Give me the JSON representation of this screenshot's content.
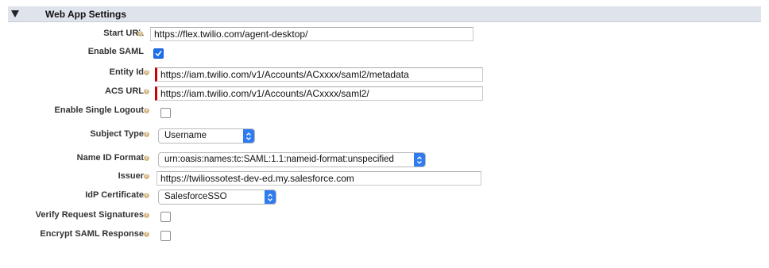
{
  "section": {
    "title": "Web App Settings"
  },
  "fields": {
    "start_url": {
      "label": "Start URL",
      "value": "https://flex.twilio.com/agent-desktop/"
    },
    "enable_saml": {
      "label": "Enable SAML",
      "checked": true
    },
    "entity_id": {
      "label": "Entity Id",
      "value": "https://iam.twilio.com/v1/Accounts/ACxxxx/saml2/metadata"
    },
    "acs_url": {
      "label": "ACS URL",
      "value": "https://iam.twilio.com/v1/Accounts/ACxxxx/saml2/"
    },
    "enable_single_logout": {
      "label": "Enable Single Logout",
      "checked": false
    },
    "subject_type": {
      "label": "Subject Type",
      "value": "Username"
    },
    "name_id_format": {
      "label": "Name ID Format",
      "value": "urn:oasis:names:tc:SAML:1.1:nameid-format:unspecified"
    },
    "issuer": {
      "label": "Issuer",
      "value": "https://twiliossotest-dev-ed.my.salesforce.com"
    },
    "idp_certificate": {
      "label": "IdP Certificate",
      "value": "SalesforceSSO"
    },
    "verify_request_signatures": {
      "label": "Verify Request Signatures",
      "checked": false
    },
    "encrypt_saml_response": {
      "label": "Encrypt SAML Response",
      "checked": false
    }
  },
  "icons": {
    "help": "help-icon",
    "collapse": "triangle-down-icon",
    "dropdown": "updown-chevron-icon",
    "check": "checkmark-icon"
  },
  "colors": {
    "header_bg": "#dfe3ec",
    "required_marker": "#cc0000",
    "select_accent": "#2f7bf0",
    "checkbox_checked": "#1f6feb"
  }
}
